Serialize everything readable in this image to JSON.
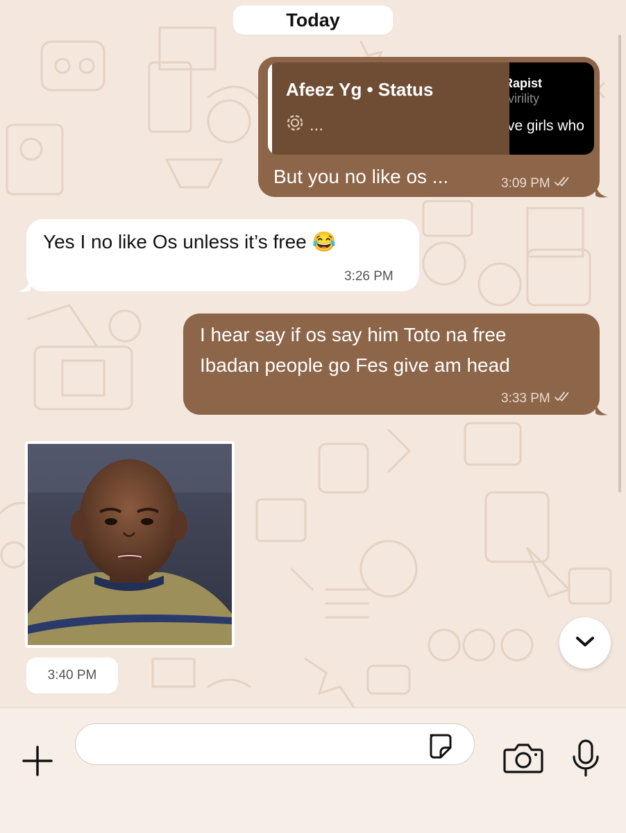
{
  "date_header": "Today",
  "messages": [
    {
      "direction": "outgoing",
      "quote": {
        "title": "Afeez Yg • Status",
        "subtitle": "...",
        "thumb_lines": [
          "Rapist",
          "virility",
          "ve girls who"
        ]
      },
      "text": "But you no like os ...",
      "time": "3:09 PM",
      "read_icon": "double-check-icon"
    },
    {
      "direction": "incoming",
      "text": "Yes I no like Os unless it’s free 😂",
      "time": "3:26 PM"
    },
    {
      "direction": "outgoing",
      "lines": [
        "I hear say if os say him Toto na free",
        "Ibadan people go Fes give am head"
      ],
      "time": "3:33 PM",
      "read_icon": "double-check-icon"
    },
    {
      "direction": "incoming",
      "type": "photo",
      "time": "3:40 PM"
    }
  ],
  "composer": {
    "input_value": "",
    "icons": [
      "plus-icon",
      "sticker-icon",
      "camera-icon",
      "microphone-icon"
    ]
  },
  "colors": {
    "outgoing_bubble": "#8d6548",
    "incoming_bubble": "#ffffff",
    "background": "#f3e7de"
  }
}
